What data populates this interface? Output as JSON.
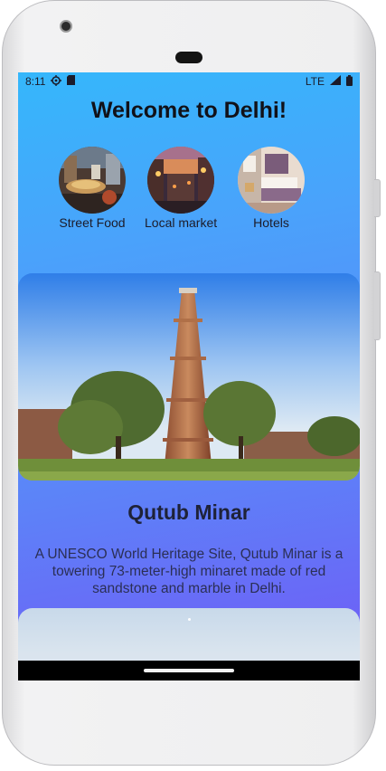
{
  "status_bar": {
    "time": "8:11",
    "network": "LTE",
    "icons": [
      "settings-icon",
      "sim-card-icon",
      "signal-icon",
      "battery-icon"
    ]
  },
  "page_title": "Welcome to Delhi!",
  "categories": [
    {
      "label": "Street Food",
      "icon": "street-food-photo"
    },
    {
      "label": "Local market",
      "icon": "local-market-photo"
    },
    {
      "label": "Hotels",
      "icon": "hotels-photo"
    }
  ],
  "featured_place": {
    "name": "Qutub Minar",
    "description": "A UNESCO World Heritage Site, Qutub Minar is a towering 73-meter-high minaret made of red sandstone and marble in Delhi.",
    "image": "qutub-minar-photo"
  },
  "colors": {
    "gradient_top": "#35b7fb",
    "gradient_bottom": "#7159f6",
    "title_text": "#111118"
  }
}
